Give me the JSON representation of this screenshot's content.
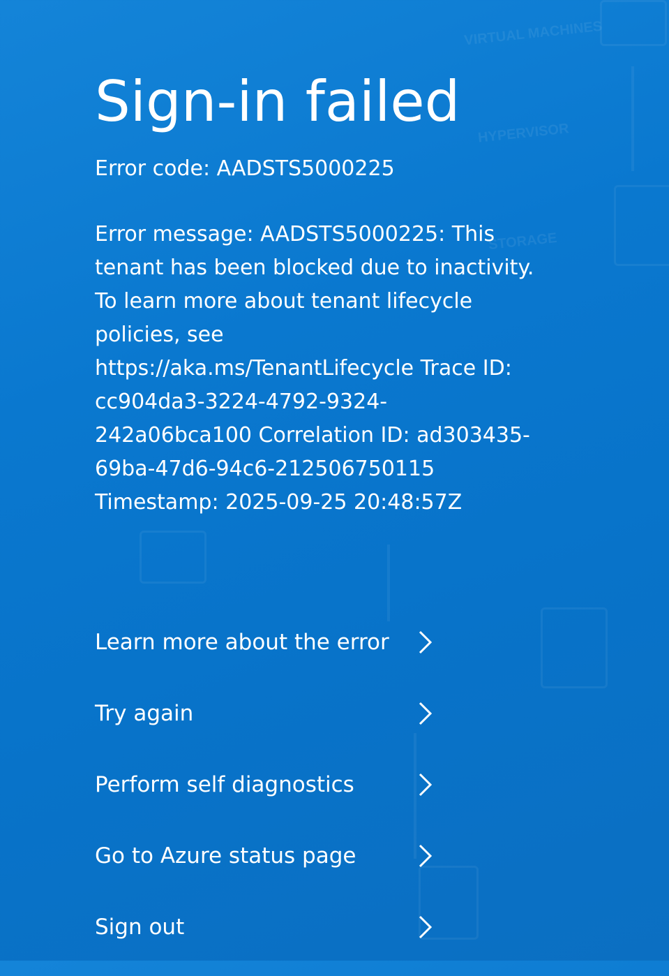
{
  "page": {
    "title": "Sign-in failed",
    "error_code": "Error code: AADSTS5000225",
    "error_message": "Error message: AADSTS5000225: This tenant has been blocked due to inactivity. To learn more about tenant lifecycle policies, see https://aka.ms/TenantLifecycle Trace ID: cc904da3-3224-4792-9324-242a06bca100 Correlation ID: ad303435-69ba-47d6-94c6-212506750115 Timestamp: 2025-09-25 20:48:57Z"
  },
  "background_labels": [
    "VIRTUAL MACHINES",
    "HYPERVISOR",
    "STORAGE"
  ],
  "actions": [
    {
      "label": "Learn more about the error",
      "icon": "chevron-right-icon"
    },
    {
      "label": "Try again",
      "icon": "chevron-right-icon"
    },
    {
      "label": "Perform self diagnostics",
      "icon": "chevron-right-icon"
    },
    {
      "label": "Go to Azure status page",
      "icon": "chevron-right-icon"
    },
    {
      "label": "Sign out",
      "icon": "chevron-right-icon"
    }
  ],
  "colors": {
    "background": "#0a78cf",
    "text": "#ffffff"
  }
}
